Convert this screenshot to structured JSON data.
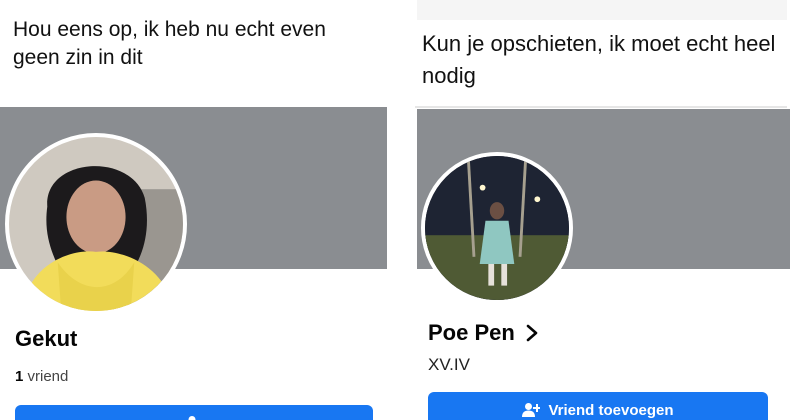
{
  "left": {
    "message": "Hou eens op, ik heb nu echt even geen zin in dit",
    "name": "Gekut",
    "friends_count": "1",
    "friends_label": "vriend"
  },
  "right": {
    "message": "Kun je opschieten, ik moet echt heel nodig",
    "name": "Poe Pen",
    "subtitle": "XV.IV",
    "add_friend_label": "Vriend toevoegen"
  },
  "colors": {
    "cover": "#8a8d91",
    "button": "#1877f2"
  }
}
